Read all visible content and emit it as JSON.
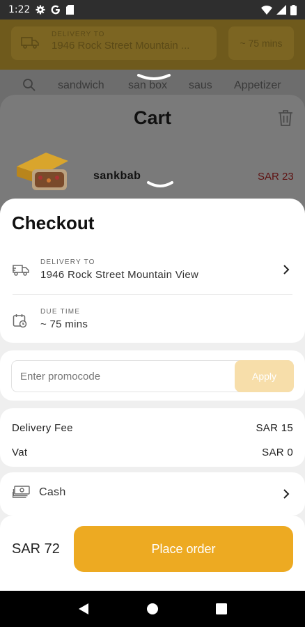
{
  "status_bar": {
    "time": "1:22"
  },
  "background": {
    "delivery_label": "DELIVERY TO",
    "delivery_address": "1946 Rock Street Mountain ...",
    "delivery_time": "~ 75 mins",
    "categories": [
      "sandwich",
      "san box",
      "saus",
      "Appetizer"
    ]
  },
  "cart": {
    "title": "Cart",
    "item_name": "sankbab",
    "item_price": "SAR 23"
  },
  "checkout": {
    "title": "Checkout",
    "delivery_label": "DELIVERY TO",
    "delivery_address": "1946 Rock Street Mountain View",
    "due_label": "DUE TIME",
    "due_value": "~ 75 mins",
    "promo_placeholder": "Enter promocode",
    "apply_label": "Apply",
    "delivery_fee_label": "Delivery Fee",
    "delivery_fee_value": "SAR 15",
    "vat_label": "Vat",
    "vat_value": "SAR 0",
    "payment_method": "Cash",
    "total": "SAR 72",
    "place_order_label": "Place order"
  },
  "colors": {
    "accent": "#edaa22",
    "apply_disabled": "#f7deaa",
    "price_text": "#5e1212"
  }
}
